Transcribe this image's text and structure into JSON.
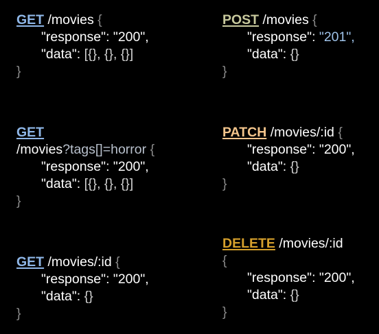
{
  "colors": {
    "get": "#8fb7e8",
    "post": "#c8c99d",
    "patch": "#f3c58c",
    "delete": "#d6a02c",
    "background": "#000000"
  },
  "endpoints": [
    {
      "method": "GET",
      "path": "/movies",
      "open_brace": "{",
      "response_key": "\"response\":",
      "response_value": "\"200\",",
      "data_key": "\"data\":",
      "data_value": "[{}, {}, {}]",
      "close_brace": "}"
    },
    {
      "method": "POST",
      "path": "/movies",
      "open_brace": "{",
      "response_key": "\"response\":",
      "response_value": "\"201\",",
      "data_key": "\"data\":",
      "data_value": "{}",
      "close_brace": "}"
    },
    {
      "method": "GET",
      "path": "/movies",
      "query": "?tags[]=horror",
      "open_brace": "{",
      "response_key": "\"response\":",
      "response_value": "\"200\",",
      "data_key": "\"data\":",
      "data_value": "[{}, {}, {}]",
      "close_brace": "}"
    },
    {
      "method": "PATCH",
      "path": "/movies/:id",
      "open_brace": "{",
      "response_key": "\"response\":",
      "response_value": "\"200\",",
      "data_key": "\"data\":",
      "data_value": "{}",
      "close_brace": "}"
    },
    {
      "method": "GET",
      "path": "/movies/:id",
      "open_brace": "{",
      "response_key": "\"response\":",
      "response_value": "\"200\",",
      "data_key": "\"data\":",
      "data_value": "{}",
      "close_brace": "}"
    },
    {
      "method": "DELETE",
      "path": "/movies/:id",
      "open_brace": "{",
      "response_key": "\"response\":",
      "response_value": "\"200\",",
      "data_key": "\"data\":",
      "data_value": "{}",
      "close_brace": "}"
    }
  ]
}
